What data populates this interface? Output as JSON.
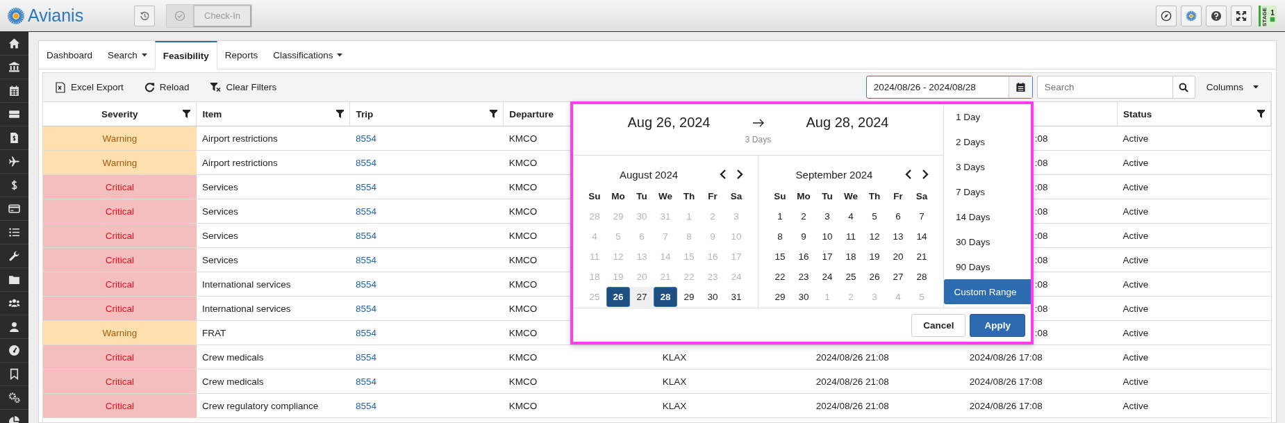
{
  "header": {
    "brand": "Avianis",
    "check_in": {
      "label": "Check-In",
      "disabled": true
    },
    "stage": {
      "label": "STAGE",
      "number": "1"
    }
  },
  "tabs": [
    {
      "label": "Dashboard",
      "selected": false,
      "has_menu": false
    },
    {
      "label": "Search",
      "selected": false,
      "has_menu": true
    },
    {
      "label": "Feasibility",
      "selected": true,
      "has_menu": false
    },
    {
      "label": "Reports",
      "selected": false,
      "has_menu": false
    },
    {
      "label": "Classifications",
      "selected": false,
      "has_menu": true
    }
  ],
  "toolbar": {
    "actions": [
      {
        "label": "Excel Export",
        "kind": "excel"
      },
      {
        "label": "Reload",
        "kind": "reload"
      },
      {
        "label": "Clear Filters",
        "kind": "clear"
      }
    ],
    "date_range": {
      "value": "2024/08/26 - 2024/08/28"
    },
    "search": {
      "placeholder": "Search"
    },
    "columns_button": "Columns"
  },
  "table": {
    "columns": [
      {
        "label": "Severity",
        "filter": true
      },
      {
        "label": "Item",
        "filter": true
      },
      {
        "label": "Trip",
        "filter": true
      },
      {
        "label": "Departure",
        "filter": false
      },
      null,
      null,
      null,
      {
        "label": "Status",
        "filter": true
      }
    ],
    "rows": [
      {
        "severity": "Warning",
        "kind": "warning",
        "item": "Airport restrictions",
        "trip": "8554",
        "departure": "KMCO",
        "covered": true,
        "column_7": ":08",
        "status": "Active"
      },
      {
        "severity": "Warning",
        "kind": "warning",
        "item": "Airport restrictions",
        "trip": "8554",
        "departure": "KMCO",
        "covered": true,
        "column_7": ":08",
        "status": "Active"
      },
      {
        "severity": "Critical",
        "kind": "critical",
        "item": "Services",
        "trip": "8554",
        "departure": "KMCO",
        "covered": true,
        "column_7": ":08",
        "status": "Active"
      },
      {
        "severity": "Critical",
        "kind": "critical",
        "item": "Services",
        "trip": "8554",
        "departure": "KMCO",
        "covered": true,
        "column_7": ":08",
        "status": "Active"
      },
      {
        "severity": "Critical",
        "kind": "critical",
        "item": "Services",
        "trip": "8554",
        "departure": "KMCO",
        "covered": true,
        "column_7": ":08",
        "status": "Active"
      },
      {
        "severity": "Critical",
        "kind": "critical",
        "item": "Services",
        "trip": "8554",
        "departure": "KMCO",
        "covered": true,
        "column_7": ":08",
        "status": "Active"
      },
      {
        "severity": "Critical",
        "kind": "critical",
        "item": "International services",
        "trip": "8554",
        "departure": "KMCO",
        "covered": true,
        "column_7": ":08",
        "status": "Active"
      },
      {
        "severity": "Critical",
        "kind": "critical",
        "item": "International services",
        "trip": "8554",
        "departure": "KMCO",
        "covered": true,
        "column_7": ":08",
        "status": "Active"
      },
      {
        "severity": "Warning",
        "kind": "warning",
        "item": "FRAT",
        "trip": "8554",
        "departure": "KMCO",
        "covered": true,
        "column_7": ":08",
        "status": "Active"
      },
      {
        "severity": "Critical",
        "kind": "critical",
        "item": "Crew medicals",
        "trip": "8554",
        "departure": "KMCO",
        "covered": false,
        "column_5": "KLAX",
        "column_6": "2024/08/26 21:08",
        "column_7": "2024/08/26 17:08",
        "status": "Active"
      },
      {
        "severity": "Critical",
        "kind": "critical",
        "item": "Crew medicals",
        "trip": "8554",
        "departure": "KMCO",
        "covered": false,
        "column_5": "KLAX",
        "column_6": "2024/08/26 21:08",
        "column_7": "2024/08/26 17:08",
        "status": "Active"
      },
      {
        "severity": "Critical",
        "kind": "critical",
        "item": "Crew regulatory compliance",
        "trip": "8554",
        "departure": "KMCO",
        "covered": false,
        "column_5": "KLAX",
        "column_6": "2024/08/26 21:08",
        "column_7": "2024/08/26 17:08",
        "status": "Active"
      }
    ]
  },
  "date_picker": {
    "start": "Aug 26, 2024",
    "end": "Aug 28, 2024",
    "duration": "3 Days",
    "calendars": [
      {
        "title": "August 2024",
        "weekdays": [
          "Su",
          "Mo",
          "Tu",
          "We",
          "Th",
          "Fr",
          "Sa"
        ],
        "weeks": [
          [
            {
              "day": "28",
              "disabled": true,
              "selected": false,
              "in_range": false
            },
            {
              "day": "29",
              "disabled": true,
              "selected": false,
              "in_range": false
            },
            {
              "day": "30",
              "disabled": true,
              "selected": false,
              "in_range": false
            },
            {
              "day": "31",
              "disabled": true,
              "selected": false,
              "in_range": false
            },
            {
              "day": "1",
              "disabled": true,
              "selected": false,
              "in_range": false
            },
            {
              "day": "2",
              "disabled": true,
              "selected": false,
              "in_range": false
            },
            {
              "day": "3",
              "disabled": true,
              "selected": false,
              "in_range": false
            }
          ],
          [
            {
              "day": "4",
              "disabled": true,
              "selected": false,
              "in_range": false
            },
            {
              "day": "5",
              "disabled": true,
              "selected": false,
              "in_range": false
            },
            {
              "day": "6",
              "disabled": true,
              "selected": false,
              "in_range": false
            },
            {
              "day": "7",
              "disabled": true,
              "selected": false,
              "in_range": false
            },
            {
              "day": "8",
              "disabled": true,
              "selected": false,
              "in_range": false
            },
            {
              "day": "9",
              "disabled": true,
              "selected": false,
              "in_range": false
            },
            {
              "day": "10",
              "disabled": true,
              "selected": false,
              "in_range": false
            }
          ],
          [
            {
              "day": "11",
              "disabled": true,
              "selected": false,
              "in_range": false
            },
            {
              "day": "12",
              "disabled": true,
              "selected": false,
              "in_range": false
            },
            {
              "day": "13",
              "disabled": true,
              "selected": false,
              "in_range": false
            },
            {
              "day": "14",
              "disabled": true,
              "selected": false,
              "in_range": false
            },
            {
              "day": "15",
              "disabled": true,
              "selected": false,
              "in_range": false
            },
            {
              "day": "16",
              "disabled": true,
              "selected": false,
              "in_range": false
            },
            {
              "day": "17",
              "disabled": true,
              "selected": false,
              "in_range": false
            }
          ],
          [
            {
              "day": "18",
              "disabled": true,
              "selected": false,
              "in_range": false
            },
            {
              "day": "19",
              "disabled": true,
              "selected": false,
              "in_range": false
            },
            {
              "day": "20",
              "disabled": true,
              "selected": false,
              "in_range": false
            },
            {
              "day": "21",
              "disabled": true,
              "selected": false,
              "in_range": false
            },
            {
              "day": "22",
              "disabled": true,
              "selected": false,
              "in_range": false
            },
            {
              "day": "23",
              "disabled": true,
              "selected": false,
              "in_range": false
            },
            {
              "day": "24",
              "disabled": true,
              "selected": false,
              "in_range": false
            }
          ],
          [
            {
              "day": "25",
              "disabled": true,
              "selected": false,
              "in_range": false
            },
            {
              "day": "26",
              "disabled": false,
              "selected": true,
              "in_range": false
            },
            {
              "day": "27",
              "disabled": false,
              "selected": false,
              "in_range": true
            },
            {
              "day": "28",
              "disabled": false,
              "selected": true,
              "in_range": false
            },
            {
              "day": "29",
              "disabled": false,
              "selected": false,
              "in_range": false
            },
            {
              "day": "30",
              "disabled": false,
              "selected": false,
              "in_range": false
            },
            {
              "day": "31",
              "disabled": false,
              "selected": false,
              "in_range": false
            }
          ]
        ]
      },
      {
        "title": "September 2024",
        "weekdays": [
          "Su",
          "Mo",
          "Tu",
          "We",
          "Th",
          "Fr",
          "Sa"
        ],
        "weeks": [
          [
            {
              "day": "1",
              "disabled": false,
              "selected": false,
              "in_range": false
            },
            {
              "day": "2",
              "disabled": false,
              "selected": false,
              "in_range": false
            },
            {
              "day": "3",
              "disabled": false,
              "selected": false,
              "in_range": false
            },
            {
              "day": "4",
              "disabled": false,
              "selected": false,
              "in_range": false
            },
            {
              "day": "5",
              "disabled": false,
              "selected": false,
              "in_range": false
            },
            {
              "day": "6",
              "disabled": false,
              "selected": false,
              "in_range": false
            },
            {
              "day": "7",
              "disabled": false,
              "selected": false,
              "in_range": false
            }
          ],
          [
            {
              "day": "8",
              "disabled": false,
              "selected": false,
              "in_range": false
            },
            {
              "day": "9",
              "disabled": false,
              "selected": false,
              "in_range": false
            },
            {
              "day": "10",
              "disabled": false,
              "selected": false,
              "in_range": false
            },
            {
              "day": "11",
              "disabled": false,
              "selected": false,
              "in_range": false
            },
            {
              "day": "12",
              "disabled": false,
              "selected": false,
              "in_range": false
            },
            {
              "day": "13",
              "disabled": false,
              "selected": false,
              "in_range": false
            },
            {
              "day": "14",
              "disabled": false,
              "selected": false,
              "in_range": false
            }
          ],
          [
            {
              "day": "15",
              "disabled": false,
              "selected": false,
              "in_range": false
            },
            {
              "day": "16",
              "disabled": false,
              "selected": false,
              "in_range": false
            },
            {
              "day": "17",
              "disabled": false,
              "selected": false,
              "in_range": false
            },
            {
              "day": "18",
              "disabled": false,
              "selected": false,
              "in_range": false
            },
            {
              "day": "19",
              "disabled": false,
              "selected": false,
              "in_range": false
            },
            {
              "day": "20",
              "disabled": false,
              "selected": false,
              "in_range": false
            },
            {
              "day": "21",
              "disabled": false,
              "selected": false,
              "in_range": false
            }
          ],
          [
            {
              "day": "22",
              "disabled": false,
              "selected": false,
              "in_range": false
            },
            {
              "day": "23",
              "disabled": false,
              "selected": false,
              "in_range": false
            },
            {
              "day": "24",
              "disabled": false,
              "selected": false,
              "in_range": false
            },
            {
              "day": "25",
              "disabled": false,
              "selected": false,
              "in_range": false
            },
            {
              "day": "26",
              "disabled": false,
              "selected": false,
              "in_range": false
            },
            {
              "day": "27",
              "disabled": false,
              "selected": false,
              "in_range": false
            },
            {
              "day": "28",
              "disabled": false,
              "selected": false,
              "in_range": false
            }
          ],
          [
            {
              "day": "29",
              "disabled": false,
              "selected": false,
              "in_range": false
            },
            {
              "day": "30",
              "disabled": false,
              "selected": false,
              "in_range": false
            },
            {
              "day": "1",
              "disabled": true,
              "selected": false,
              "in_range": false
            },
            {
              "day": "2",
              "disabled": true,
              "selected": false,
              "in_range": false
            },
            {
              "day": "3",
              "disabled": true,
              "selected": false,
              "in_range": false
            },
            {
              "day": "4",
              "disabled": true,
              "selected": false,
              "in_range": false
            },
            {
              "day": "5",
              "disabled": true,
              "selected": false,
              "in_range": false
            }
          ]
        ]
      }
    ],
    "presets": [
      {
        "label": "1 Day",
        "selected": false
      },
      {
        "label": "2 Days",
        "selected": false
      },
      {
        "label": "3 Days",
        "selected": false
      },
      {
        "label": "7 Days",
        "selected": false
      },
      {
        "label": "14 Days",
        "selected": false
      },
      {
        "label": "30 Days",
        "selected": false
      },
      {
        "label": "90 Days",
        "selected": false
      },
      {
        "label": "Custom Range",
        "selected": true
      }
    ],
    "buttons": [
      {
        "label": "Cancel",
        "kind": "default"
      },
      {
        "label": "Apply",
        "kind": "primary"
      }
    ]
  }
}
